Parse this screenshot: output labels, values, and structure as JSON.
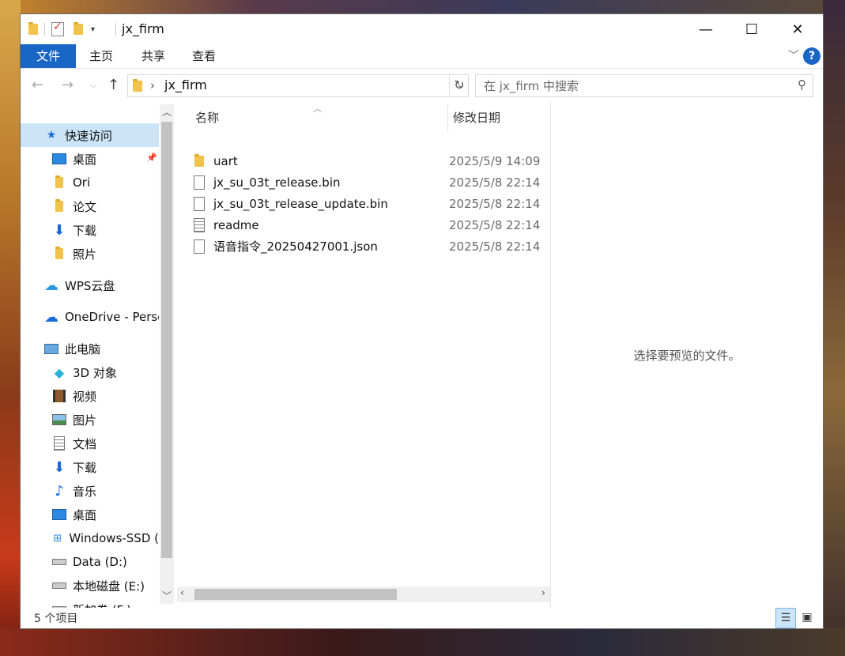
{
  "window": {
    "title": "jx_firm",
    "controls": {
      "minimize": "—",
      "maximize": "☐",
      "close": "✕"
    }
  },
  "ribbon": {
    "tabs": [
      "文件",
      "主页",
      "共享",
      "查看"
    ],
    "help": "?"
  },
  "address": {
    "path": "jx_firm",
    "search_placeholder": "在 jx_firm 中搜索"
  },
  "sidebar": {
    "items": [
      {
        "label": "快速访问",
        "icon": "star-icon"
      },
      {
        "label": "桌面",
        "icon": "desktop-icon"
      },
      {
        "label": "Ori",
        "icon": "folder-icon"
      },
      {
        "label": "论文",
        "icon": "folder-icon"
      },
      {
        "label": "下载",
        "icon": "download-icon"
      },
      {
        "label": "照片",
        "icon": "folder-icon"
      },
      {
        "label": "WPS云盘",
        "icon": "cloud-icon"
      },
      {
        "label": "OneDrive - Perso",
        "icon": "cloud-icon"
      },
      {
        "label": "此电脑",
        "icon": "computer-icon"
      },
      {
        "label": "3D 对象",
        "icon": "cube-icon"
      },
      {
        "label": "视频",
        "icon": "video-icon"
      },
      {
        "label": "图片",
        "icon": "picture-icon"
      },
      {
        "label": "文档",
        "icon": "document-icon"
      },
      {
        "label": "下载",
        "icon": "download-icon"
      },
      {
        "label": "音乐",
        "icon": "music-icon"
      },
      {
        "label": "桌面",
        "icon": "desktop-icon"
      },
      {
        "label": "Windows-SSD (",
        "icon": "drive-icon"
      },
      {
        "label": "Data (D:)",
        "icon": "drive-icon"
      },
      {
        "label": "本地磁盘 (E:)",
        "icon": "drive-icon"
      },
      {
        "label": "新加卷 (F:)",
        "icon": "drive-icon"
      }
    ]
  },
  "filelist": {
    "columns": {
      "name": "名称",
      "date": "修改日期"
    },
    "rows": [
      {
        "name": "uart",
        "date": "2025/5/9 14:09",
        "icon": "folder-icon"
      },
      {
        "name": "jx_su_03t_release.bin",
        "date": "2025/5/8 22:14",
        "icon": "file-icon"
      },
      {
        "name": "jx_su_03t_release_update.bin",
        "date": "2025/5/8 22:14",
        "icon": "file-icon"
      },
      {
        "name": "readme",
        "date": "2025/5/8 22:14",
        "icon": "text-file-icon"
      },
      {
        "name": "语音指令_20250427001.json",
        "date": "2025/5/8 22:14",
        "icon": "file-icon"
      }
    ]
  },
  "preview": {
    "message": "选择要预览的文件。"
  },
  "status": {
    "item_count": "5 个项目"
  }
}
